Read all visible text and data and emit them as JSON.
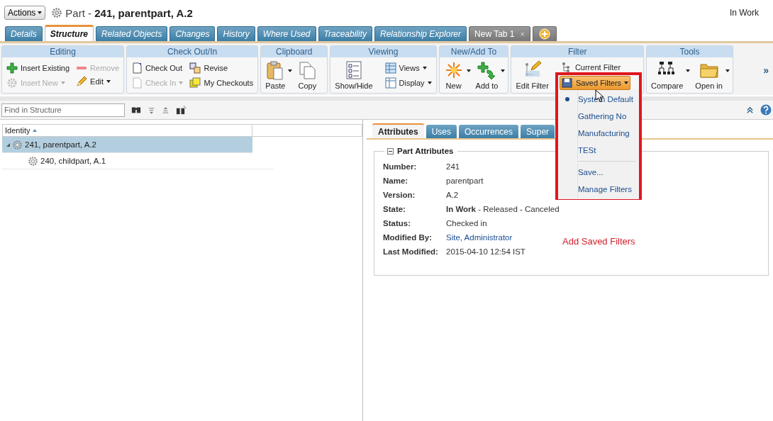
{
  "header": {
    "actions_button": "Actions",
    "title": "Part - **241, parentpart, A.2**",
    "state": "In Work"
  },
  "tabs": [
    {
      "label": "Details",
      "selected": false,
      "kind": "page"
    },
    {
      "label": "Structure",
      "selected": true,
      "kind": "page"
    },
    {
      "label": "Related Objects",
      "selected": false,
      "kind": "page"
    },
    {
      "label": "Changes",
      "selected": false,
      "kind": "page"
    },
    {
      "label": "History",
      "selected": false,
      "kind": "page"
    },
    {
      "label": "Where Used",
      "selected": false,
      "kind": "page"
    },
    {
      "label": "Traceability",
      "selected": false,
      "kind": "page"
    },
    {
      "label": "Relationship Explorer",
      "selected": false,
      "kind": "page"
    },
    {
      "label": "New Tab 1",
      "selected": false,
      "kind": "custom",
      "close": "×"
    },
    {
      "selected": false,
      "kind": "add"
    }
  ],
  "ribbon": {
    "overflow": "»",
    "groups": [
      {
        "title": "Editing",
        "columns": [
          [
            {
              "label": "Insert Existing",
              "kind": "small",
              "disabled": false,
              "dropdown": false
            },
            {
              "label": "Insert New",
              "kind": "small",
              "disabled": true,
              "dropdown": true
            }
          ],
          [
            {
              "label": "Remove",
              "kind": "small",
              "disabled": true,
              "dropdown": false
            },
            {
              "label": "Edit",
              "kind": "small",
              "disabled": false,
              "dropdown": true
            }
          ]
        ]
      },
      {
        "title": "Check Out/In",
        "columns": [
          [
            {
              "label": "Check Out",
              "kind": "small",
              "disabled": false,
              "dropdown": false
            },
            {
              "label": "Check In",
              "kind": "small",
              "disabled": true,
              "dropdown": true
            }
          ],
          [
            {
              "label": "Revise",
              "kind": "small",
              "disabled": false,
              "dropdown": false
            },
            {
              "label": "My Checkouts",
              "kind": "small",
              "disabled": false,
              "dropdown": false
            }
          ]
        ]
      },
      {
        "title": "Clipboard",
        "columns": [
          [
            {
              "label": "Paste",
              "kind": "large",
              "disabled": false,
              "dropdown": true
            }
          ],
          [
            {
              "label": "Copy",
              "kind": "large",
              "disabled": false,
              "dropdown": false
            }
          ]
        ]
      },
      {
        "title": "Viewing",
        "columns": [
          [
            {
              "label": "Show/Hide",
              "kind": "large",
              "disabled": false,
              "dropdown": false
            }
          ],
          [
            {
              "label": "Views",
              "kind": "small",
              "disabled": false,
              "dropdown": true
            },
            {
              "label": "Display",
              "kind": "small",
              "disabled": false,
              "dropdown": true
            }
          ]
        ]
      },
      {
        "title": "New/Add To",
        "columns": [
          [
            {
              "label": "New",
              "kind": "large",
              "disabled": false,
              "dropdown": true
            }
          ],
          [
            {
              "label": "Add to",
              "kind": "large",
              "disabled": false,
              "dropdown": true
            }
          ]
        ]
      },
      {
        "title": "Filter",
        "columns": [
          [
            {
              "label": "Edit Filter",
              "kind": "large",
              "disabled": false,
              "dropdown": false
            }
          ],
          [
            {
              "label": "Current Filter",
              "kind": "small",
              "disabled": false,
              "dropdown": false
            },
            {
              "label": "Saved Filters",
              "kind": "small",
              "disabled": false,
              "dropdown": true,
              "active": true
            }
          ]
        ]
      },
      {
        "title": "Tools",
        "columns": [
          [
            {
              "label": "Compare",
              "kind": "large",
              "disabled": false,
              "dropdown": true
            }
          ],
          [
            {
              "label": "Open in",
              "kind": "large",
              "disabled": false,
              "dropdown": true
            }
          ]
        ]
      }
    ]
  },
  "saved_filters_menu": {
    "sections": [
      [
        {
          "label": "System Default",
          "selected": true
        },
        {
          "label": "Gathering No",
          "selected": false
        },
        {
          "label": "Manufacturing",
          "selected": false
        },
        {
          "label": "TESt",
          "selected": false
        }
      ],
      [
        {
          "label": "Save...",
          "selected": false
        },
        {
          "label": "Manage Filters",
          "selected": false
        }
      ]
    ]
  },
  "find": {
    "placeholder": "Find in Structure"
  },
  "tree": {
    "columns": [
      {
        "label": "Identity",
        "sort_ascending": true
      }
    ],
    "rows": [
      {
        "label": "241, parentpart, A.2",
        "expanded": true,
        "selected": true,
        "children": [
          {
            "label": "240, childpart, A.1",
            "selected": false
          }
        ]
      }
    ]
  },
  "detail_tabs": [
    {
      "label": "Attributes",
      "selected": true
    },
    {
      "label": "Uses",
      "selected": false
    },
    {
      "label": "Occurrences",
      "selected": false
    },
    {
      "label": "Super",
      "selected": false
    }
  ],
  "attributes": {
    "title": "Part Attributes",
    "expanded": true,
    "fields": [
      {
        "label": "Number:",
        "value": "241",
        "kind": "text"
      },
      {
        "label": "Name:",
        "value": "parentpart",
        "kind": "text"
      },
      {
        "label": "Version:",
        "value": "A.2",
        "kind": "text"
      },
      {
        "label": "State:",
        "value": "**In Work** - Released - Canceled",
        "kind": "text"
      },
      {
        "label": "Status:",
        "value": "Checked in",
        "kind": "text"
      },
      {
        "label": "Modified By:",
        "value": "Site, Administrator",
        "kind": "link"
      },
      {
        "label": "Last Modified:",
        "value": "2015-04-10 12:54 IST",
        "kind": "text"
      }
    ]
  },
  "annotation": {
    "text": "Add Saved Filters"
  }
}
